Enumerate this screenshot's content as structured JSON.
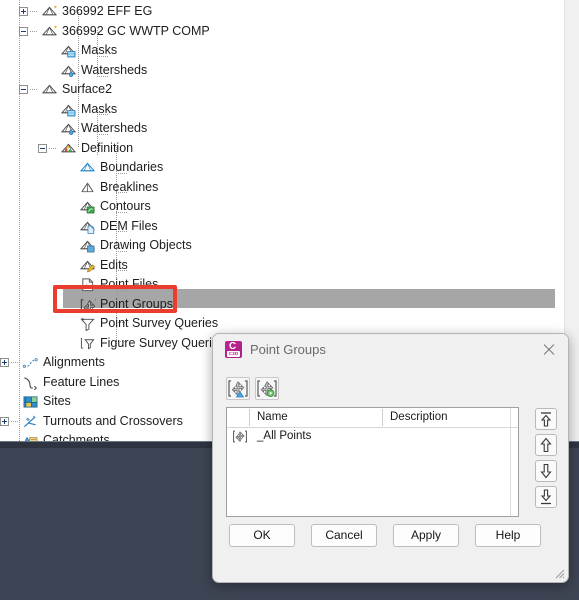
{
  "tree": {
    "items": [
      {
        "label": "366992 EFF EG",
        "indent": 0,
        "icon": "surface-icon",
        "expander": "plus"
      },
      {
        "label": "366992 GC WWTP COMP",
        "indent": 0,
        "icon": "surface-icon",
        "expander": "minus"
      },
      {
        "label": "Masks",
        "indent": 1,
        "icon": "masks-icon",
        "expander": "none"
      },
      {
        "label": "Watersheds",
        "indent": 1,
        "icon": "watersheds-icon",
        "expander": "none"
      },
      {
        "label": "Surface2",
        "indent": 0,
        "icon": "surface-plain-icon",
        "expander": "minus"
      },
      {
        "label": "Masks",
        "indent": 1,
        "icon": "masks-icon",
        "expander": "none"
      },
      {
        "label": "Watersheds",
        "indent": 1,
        "icon": "watersheds-icon",
        "expander": "none"
      },
      {
        "label": "Definition",
        "indent": 1,
        "icon": "definition-icon",
        "expander": "minus"
      },
      {
        "label": "Boundaries",
        "indent": 2,
        "icon": "boundaries-icon",
        "expander": "none"
      },
      {
        "label": "Breaklines",
        "indent": 2,
        "icon": "breaklines-icon",
        "expander": "none"
      },
      {
        "label": "Contours",
        "indent": 2,
        "icon": "contours-icon",
        "expander": "none"
      },
      {
        "label": "DEM Files",
        "indent": 2,
        "icon": "dem-files-icon",
        "expander": "none"
      },
      {
        "label": "Drawing Objects",
        "indent": 2,
        "icon": "drawing-objects-icon",
        "expander": "none"
      },
      {
        "label": "Edits",
        "indent": 2,
        "icon": "edits-icon",
        "expander": "none"
      },
      {
        "label": "Point Files",
        "indent": 2,
        "icon": "point-files-icon",
        "expander": "none"
      },
      {
        "label": "Point Groups",
        "indent": 2,
        "icon": "point-groups-icon",
        "expander": "none"
      },
      {
        "label": "Point Survey Queries",
        "indent": 2,
        "icon": "point-survey-icon",
        "expander": "none"
      },
      {
        "label": "Figure Survey Queries",
        "indent": 2,
        "icon": "figure-survey-icon",
        "expander": "none"
      },
      {
        "label": "Alignments",
        "indent": -1,
        "icon": "alignments-icon",
        "expander": "plus"
      },
      {
        "label": "Feature Lines",
        "indent": -1,
        "icon": "feature-lines-icon",
        "expander": "none"
      },
      {
        "label": "Sites",
        "indent": -1,
        "icon": "sites-icon",
        "expander": "none"
      },
      {
        "label": "Turnouts and Crossovers",
        "indent": -1,
        "icon": "turnouts-icon",
        "expander": "plus"
      },
      {
        "label": "Catchments",
        "indent": -1,
        "icon": "catchments-icon",
        "expander": "none"
      }
    ],
    "selected_label": "Point Groups",
    "highlight_color": "#a6a6a6",
    "annotation_color": "#ec3c2d"
  },
  "dialog": {
    "title": "Point Groups",
    "app_icon_letter": "C",
    "app_icon_badge": "C3D",
    "app_icon_color": "#b5238e",
    "close_label": "Close",
    "toolbar": [
      {
        "name": "create-point-group-button",
        "tooltip": "Create point group"
      },
      {
        "name": "point-group-properties-button",
        "tooltip": "Point group properties"
      }
    ],
    "list": {
      "columns": [
        "Name",
        "Description"
      ],
      "rows": [
        {
          "name": "_All Points",
          "description": ""
        }
      ]
    },
    "order_buttons": [
      {
        "name": "move-to-top-button",
        "glyph": "top"
      },
      {
        "name": "move-up-button",
        "glyph": "up"
      },
      {
        "name": "move-down-button",
        "glyph": "down"
      },
      {
        "name": "move-to-bottom-button",
        "glyph": "bottom"
      }
    ],
    "buttons": [
      {
        "label": "OK"
      },
      {
        "label": "Cancel"
      },
      {
        "label": "Apply"
      },
      {
        "label": "Help"
      }
    ]
  }
}
